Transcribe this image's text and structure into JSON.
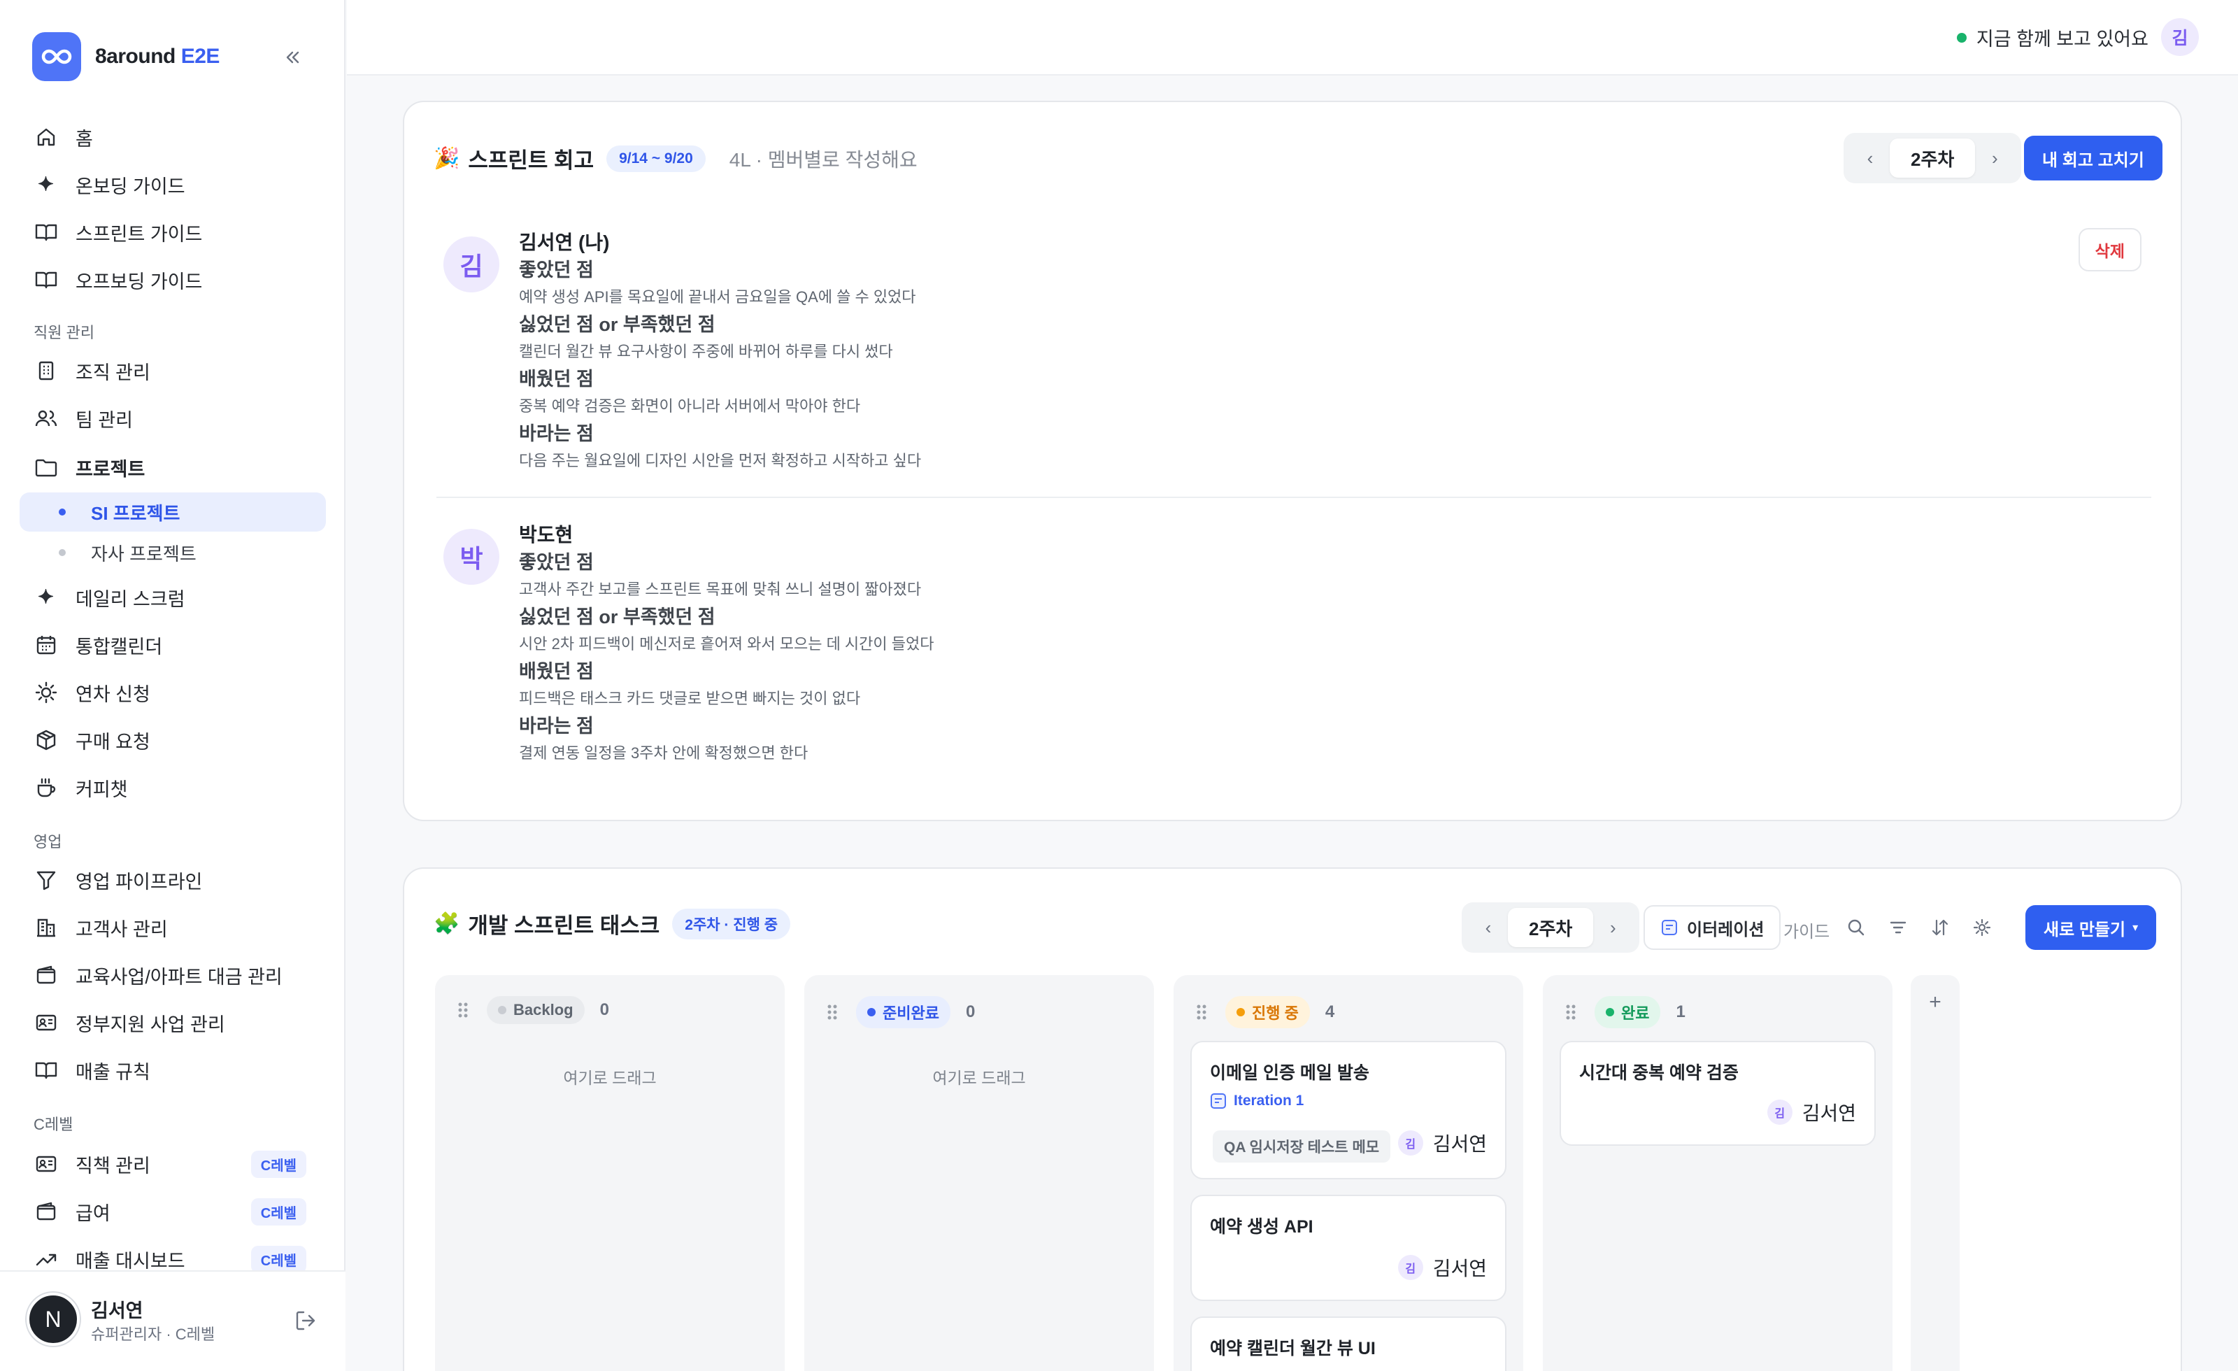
{
  "brand": {
    "name_main": "8around",
    "name_accent": "E2E"
  },
  "nav": {
    "home": "홈",
    "onboarding": "온보딩 가이드",
    "sprint_guide": "스프린트 가이드",
    "offboarding": "오프보딩 가이드",
    "section_staff": "직원 관리",
    "org": "조직 관리",
    "team": "팀 관리",
    "project": "프로젝트",
    "project_si": "SI 프로젝트",
    "project_own": "자사 프로젝트",
    "daily_scrum": "데일리 스크럼",
    "calendar": "통합캘린더",
    "leave": "연차 신청",
    "purchase": "구매 요청",
    "coffee": "커피챗",
    "section_sales": "영업",
    "pipeline": "영업 파이프라인",
    "clients": "고객사 관리",
    "edu": "교육사업/아파트 대금 관리",
    "gov": "정부지원 사업 관리",
    "revenue_rules": "매출 규칙",
    "section_c": "C레벨",
    "position": "직책 관리",
    "salary": "급여",
    "revenue_dash": "매출 대시보드",
    "c_badge": "C레벨"
  },
  "user": {
    "avatar": "N",
    "name": "김서연",
    "role": "슈퍼관리자 · C레벨"
  },
  "topbar": {
    "live_text": "지금 함께 보고 있어요",
    "avatar": "김"
  },
  "retro": {
    "emoji": "🎉",
    "title": "스프린트 회고",
    "dates": "9/14 ~ 9/20",
    "subtitle": "4L · 멤버별로 작성해요",
    "week_prev": "‹",
    "week": "2주차",
    "week_next": "›",
    "edit_button": "내 회고 고치기",
    "delete_button": "삭제",
    "entries": [
      {
        "avatar": "김",
        "name": "김서연 (나)",
        "q1": "좋았던 점",
        "a1": "예약 생성 API를 목요일에 끝내서 금요일을 QA에 쓸 수 있었다",
        "q2": "싫었던 점 or 부족했던 점",
        "a2": "캘린더 월간 뷰 요구사항이 주중에 바뀌어 하루를 다시 썼다",
        "q3": "배웠던 점",
        "a3": "중복 예약 검증은 화면이 아니라 서버에서 막아야 한다",
        "q4": "바라는 점",
        "a4": "다음 주는 월요일에 디자인 시안을 먼저 확정하고 시작하고 싶다"
      },
      {
        "avatar": "박",
        "name": "박도현",
        "q1": "좋았던 점",
        "a1": "고객사 주간 보고를 스프린트 목표에 맞춰 쓰니 설명이 짧아졌다",
        "q2": "싫었던 점 or 부족했던 점",
        "a2": "시안 2차 피드백이 메신저로 흩어져 와서 모으는 데 시간이 들었다",
        "q3": "배웠던 점",
        "a3": "피드백은 태스크 카드 댓글로 받으면 빠지는 것이 없다",
        "q4": "바라는 점",
        "a4": "결제 연동 일정을 3주차 안에 확정했으면 한다"
      }
    ]
  },
  "dev": {
    "emoji": "🧩",
    "title": "개발 스프린트 태스크",
    "status_pill": "2주차 · 진행 중",
    "week_prev": "‹",
    "week": "2주차",
    "week_next": "›",
    "iteration_button": "이터레이션",
    "guide": "가이드",
    "new_button": "새로 만들기",
    "new_caret": "▾",
    "drop_hint": "여기로 드래그",
    "columns": [
      {
        "label": "Backlog",
        "count": "0",
        "color": "#c9ccd2",
        "bg": "#e9ebee",
        "fg": "#5f6670"
      },
      {
        "label": "준비완료",
        "count": "0",
        "color": "#3a5ff0",
        "bg": "#e8eefe",
        "fg": "#2f55e8"
      },
      {
        "label": "진행 중",
        "count": "4",
        "color": "#f59e0b",
        "bg": "#fff3dc",
        "fg": "#d97706"
      },
      {
        "label": "완료",
        "count": "1",
        "color": "#19b36b",
        "bg": "#e2f6ec",
        "fg": "#129a5a"
      }
    ],
    "tasks": {
      "t1": {
        "title": "이메일 인증 메일 발송",
        "iteration": "Iteration 1",
        "tag": "QA 임시저장 테스트 메모",
        "assignee_avatar": "김",
        "assignee": "김서연"
      },
      "t2": {
        "title": "예약 생성 API",
        "assignee_avatar": "김",
        "assignee": "김서연"
      },
      "t3": {
        "title": "예약 캘린더 월간 뷰 UI"
      },
      "t4": {
        "title": "시간대 중복 예약 검증",
        "assignee_avatar": "김",
        "assignee": "김서연"
      }
    },
    "add_column": "+"
  }
}
